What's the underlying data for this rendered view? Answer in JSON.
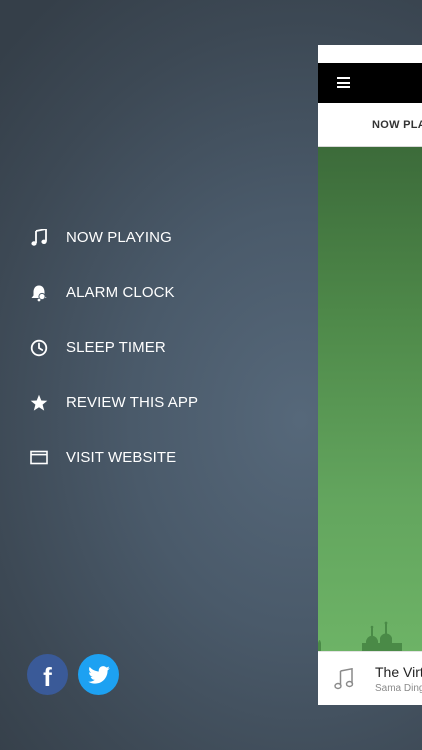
{
  "menu": {
    "items": [
      {
        "label": "NOW PLAYING",
        "icon": "music-note-icon"
      },
      {
        "label": "ALARM CLOCK",
        "icon": "alarm-bell-icon"
      },
      {
        "label": "SLEEP TIMER",
        "icon": "clock-icon"
      },
      {
        "label": "REVIEW THIS APP",
        "icon": "star-icon"
      },
      {
        "label": "VISIT WEBSITE",
        "icon": "browser-window-icon"
      }
    ]
  },
  "social": {
    "facebook": {
      "glyph": "f",
      "color": "#3a5a98"
    },
    "twitter": {
      "color": "#1da1f2"
    }
  },
  "panel": {
    "tab_label": "NOW PLAYING",
    "now_playing": {
      "title": "The Virtues",
      "artist": "Sama Dinga"
    }
  },
  "colors": {
    "background": "#45525e",
    "artwork_green": "#5a9a55",
    "navbar": "#000000"
  }
}
